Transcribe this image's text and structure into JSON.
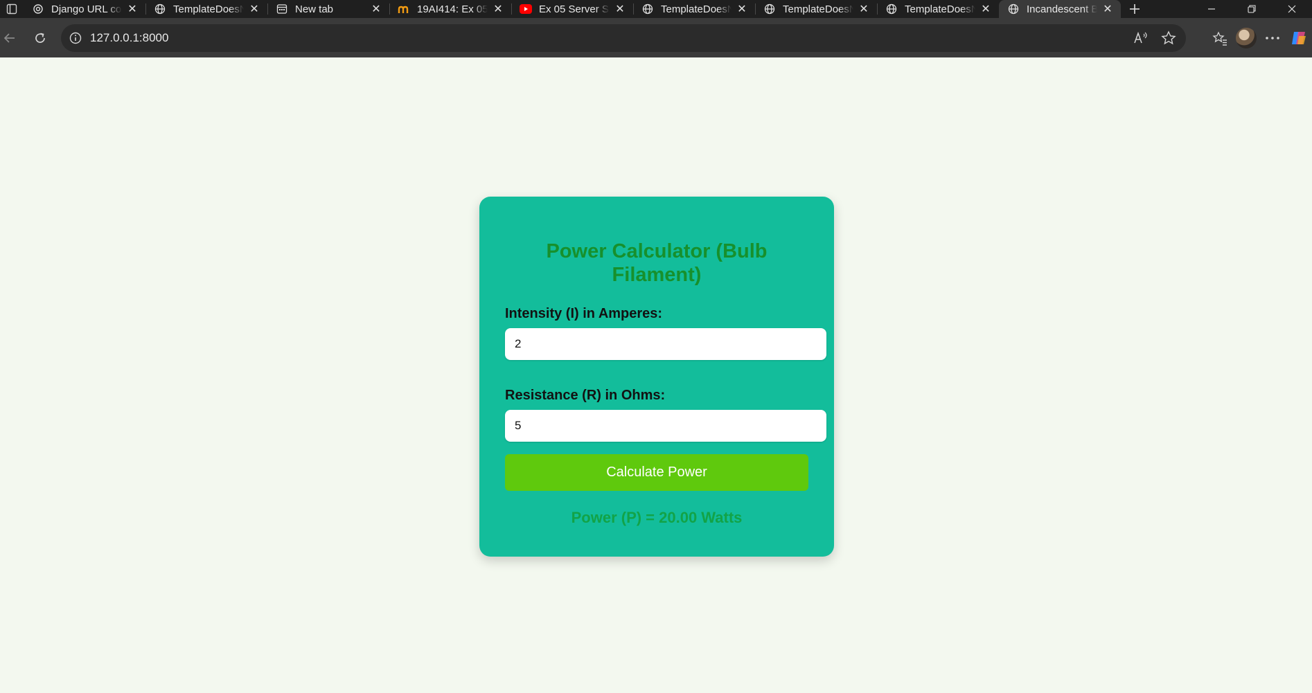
{
  "browser": {
    "tabs": [
      {
        "title": "Django URL co",
        "icon": "openai-logo-icon",
        "active": false
      },
      {
        "title": "TemplateDoesN",
        "icon": "globe-icon",
        "active": false
      },
      {
        "title": "New tab",
        "icon": "new-tab-page-icon",
        "active": false
      },
      {
        "title": "19AI414: Ex 05",
        "icon": "moodle-logo-icon",
        "active": false
      },
      {
        "title": "Ex 05 Server Si",
        "icon": "youtube-logo-icon",
        "active": false
      },
      {
        "title": "TemplateDoesN",
        "icon": "globe-icon",
        "active": false
      },
      {
        "title": "TemplateDoesN",
        "icon": "globe-icon",
        "active": false
      },
      {
        "title": "TemplateDoesN",
        "icon": "globe-icon",
        "active": false
      },
      {
        "title": "Incandescent B",
        "icon": "globe-icon",
        "active": true
      }
    ],
    "url": "127.0.0.1:8000"
  },
  "page": {
    "title": "Power Calculator (Bulb Filament)",
    "intensity_label": "Intensity (I) in Amperes:",
    "intensity_value": "2",
    "resistance_label": "Resistance (R) in Ohms:",
    "resistance_value": "5",
    "button_label": "Calculate Power",
    "result": "Power (P) = 20.00 Watts"
  },
  "colors": {
    "page_background": "#f3f8ef",
    "card_background": "#13bd9b",
    "title_color": "#17902c",
    "button_color": "#5fc90d",
    "result_color": "#12a347"
  }
}
